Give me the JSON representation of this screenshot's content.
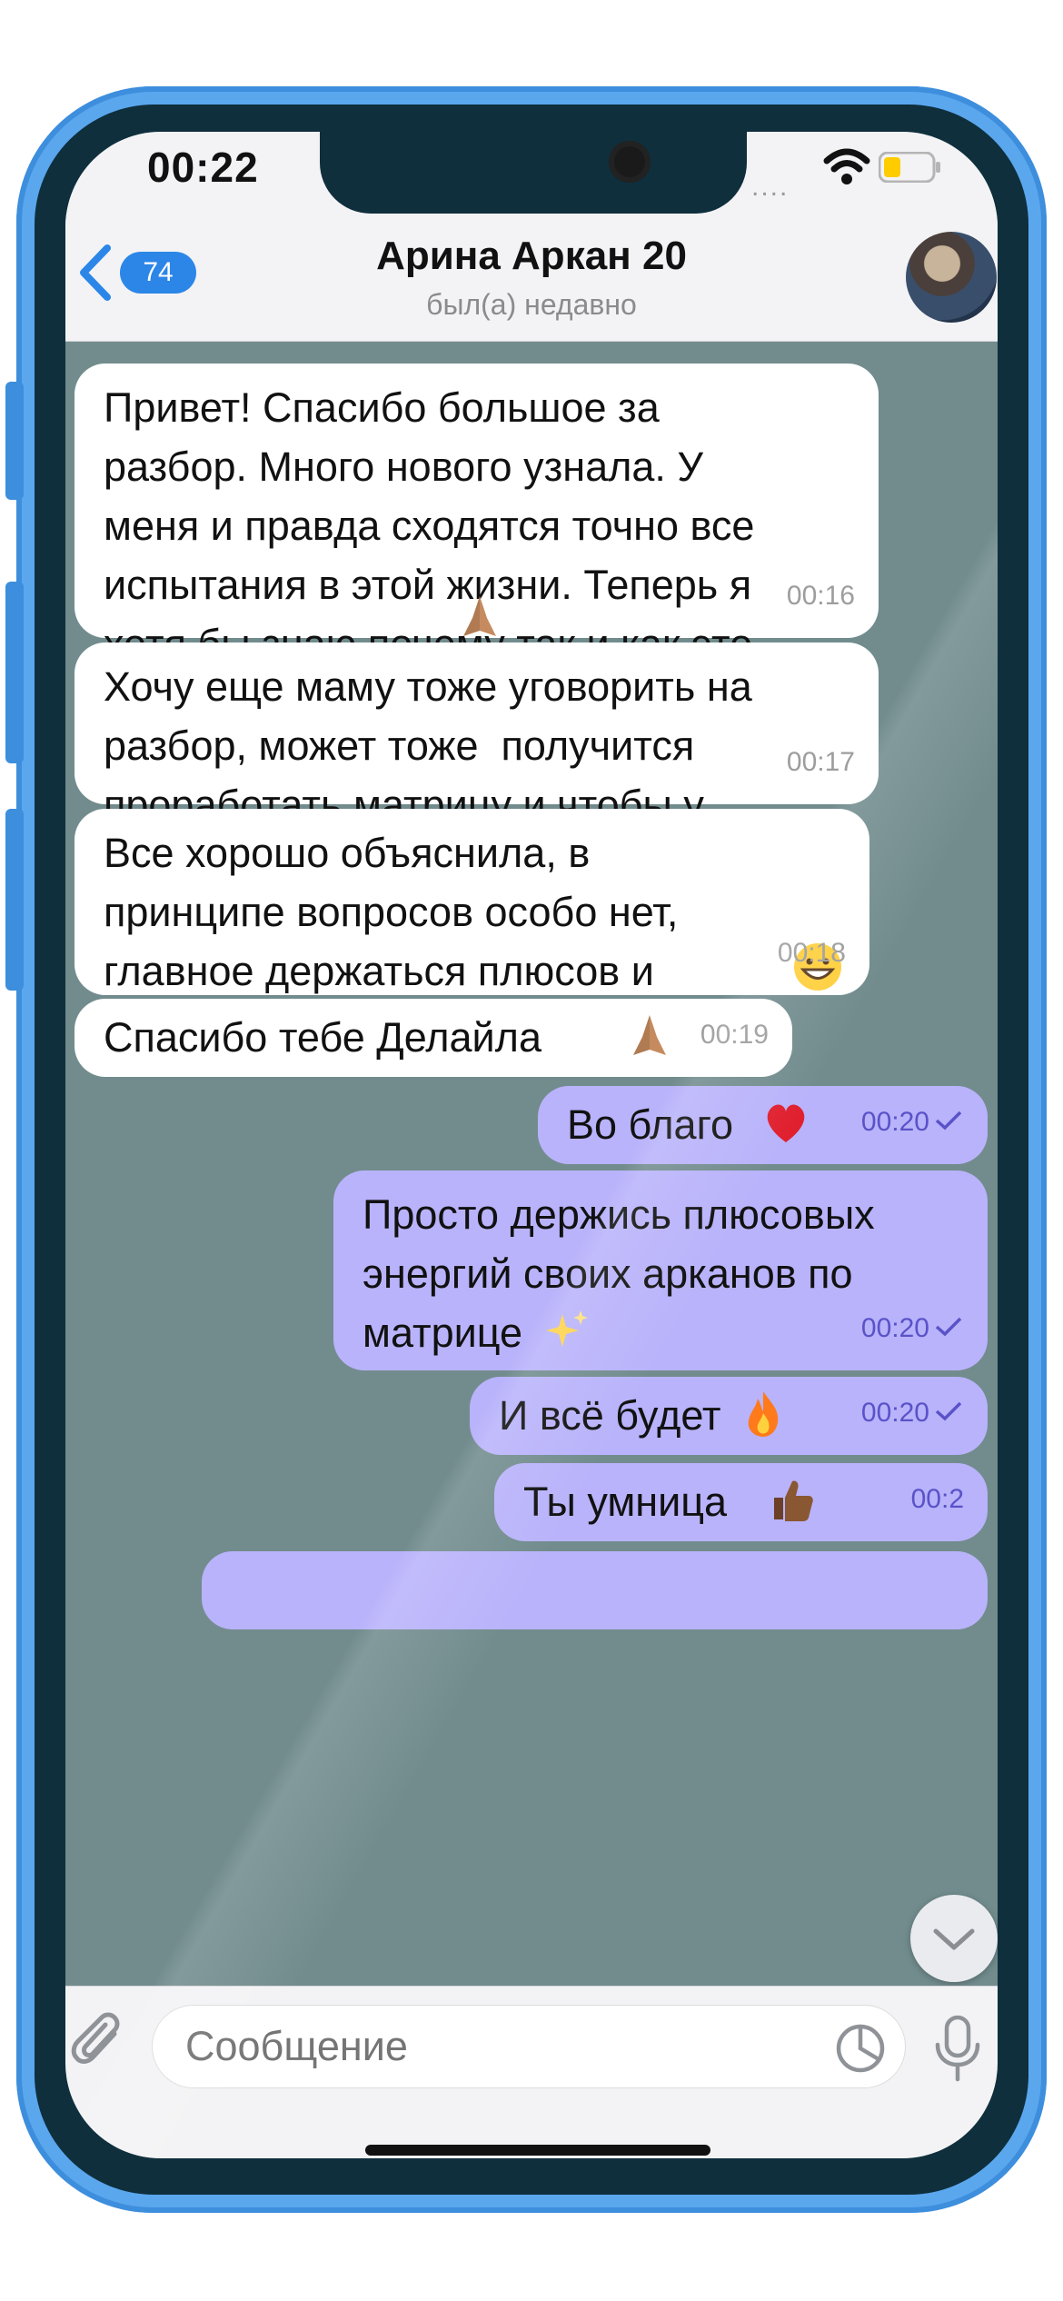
{
  "status_bar": {
    "time": "00:22",
    "signal": "....",
    "battery_color": "#ffcc00"
  },
  "header": {
    "back_badge": "74",
    "title": "Арина Аркан 20",
    "status": "был(а) недавно"
  },
  "messages": [
    {
      "direction": "in",
      "text": "Привет! Спасибо большое за\nразбор. Много нового узнала. У\nменя и правда сходятся точно все\nиспытания в этой жизни. Теперь я\nхотя бы знаю почему так и как это\nможно избежать, применяя эти\nзнания в жизнь",
      "emoji": "folded-hands-medium",
      "time": "00:16"
    },
    {
      "direction": "in",
      "text": "Хочу еще маму тоже уговорить на\nразбор, может тоже  получится\nпроработать матрицу и чтобы у\nнее жизнь поменялась",
      "time": "00:17"
    },
    {
      "direction": "in",
      "text": "Все хорошо объяснила, в\nпринципе вопросов особо нет,\nглавное держаться плюсов и\nизбегать запретов по матрице",
      "emoji": "grinning-face",
      "time": "00:18"
    },
    {
      "direction": "in",
      "text": "Спасибо тебе Делайла",
      "emoji": "folded-hands-medium",
      "time": "00:19"
    },
    {
      "direction": "out",
      "text": "Во благо",
      "emoji": "red-heart",
      "time": "00:20",
      "read": true
    },
    {
      "direction": "out",
      "text": "Просто держись плюсовых\nэнергий своих арканов по\nматрице",
      "emoji": "sparkles",
      "time": "00:20",
      "read": true
    },
    {
      "direction": "out",
      "text": "И всё будет",
      "emoji": "fire",
      "time": "00:20",
      "read": true
    },
    {
      "direction": "out",
      "text": "Ты умница",
      "emoji": "thumbs-up-dark",
      "time": "00:2",
      "read": true
    }
  ],
  "input": {
    "placeholder": "Сообщение"
  },
  "icons": {
    "back": "chevron-left-icon",
    "attach": "paperclip-icon",
    "sticker": "sticker-icon",
    "mic": "microphone-icon",
    "scroll": "chevron-down-icon"
  },
  "colors": {
    "accent": "#2b86e8",
    "outgoing_bubble": "#b9b3fb",
    "chat_background": "#728c8e"
  }
}
